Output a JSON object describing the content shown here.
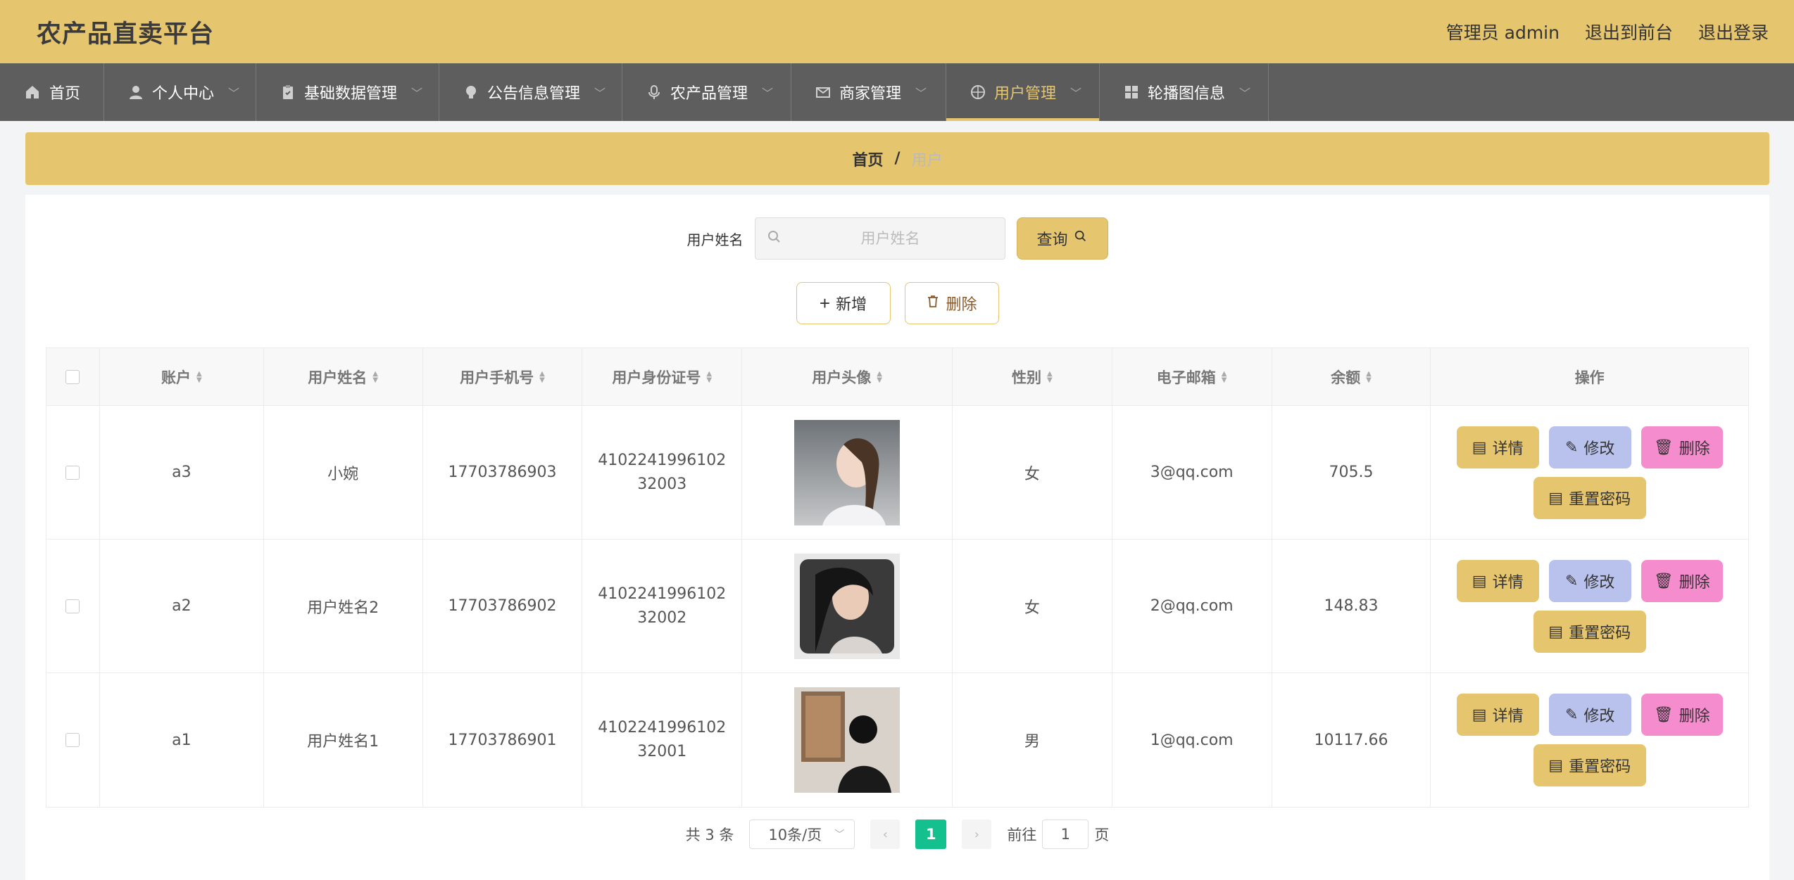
{
  "header": {
    "brand": "农产品直卖平台",
    "admin_label": "管理员 admin",
    "front_link": "退出到前台",
    "logout_link": "退出登录"
  },
  "nav": {
    "items": [
      {
        "label": "首页",
        "icon": "home-icon"
      },
      {
        "label": "个人中心",
        "icon": "user-icon"
      },
      {
        "label": "基础数据管理",
        "icon": "clipboard-icon"
      },
      {
        "label": "公告信息管理",
        "icon": "bulb-icon"
      },
      {
        "label": "农产品管理",
        "icon": "mic-icon"
      },
      {
        "label": "商家管理",
        "icon": "mail-icon"
      },
      {
        "label": "用户管理",
        "icon": "compass-icon"
      },
      {
        "label": "轮播图信息",
        "icon": "grid-icon"
      }
    ],
    "active": "用户管理"
  },
  "breadcrumb": {
    "home": "首页",
    "separator": "/",
    "current": "用户"
  },
  "search": {
    "label": "用户姓名",
    "placeholder": "用户姓名",
    "value": "",
    "button": "查询"
  },
  "actions": {
    "add": "新增",
    "delete": "删除"
  },
  "table": {
    "columns": [
      "账户",
      "用户姓名",
      "用户手机号",
      "用户身份证号",
      "用户头像",
      "性别",
      "电子邮箱",
      "余额",
      "操作"
    ],
    "rows": [
      {
        "account": "a3",
        "name": "小婉",
        "phone": "17703786903",
        "id_card": "410224199610232003",
        "gender": "女",
        "email": "3@qq.com",
        "balance": "705.5"
      },
      {
        "account": "a2",
        "name": "用户姓名2",
        "phone": "17703786902",
        "id_card": "410224199610232002",
        "gender": "女",
        "email": "2@qq.com",
        "balance": "148.83"
      },
      {
        "account": "a1",
        "name": "用户姓名1",
        "phone": "17703786901",
        "id_card": "410224199610232001",
        "gender": "男",
        "email": "1@qq.com",
        "balance": "10117.66"
      }
    ],
    "ops": {
      "detail": "详情",
      "edit": "修改",
      "delete": "删除",
      "reset": "重置密码"
    }
  },
  "pagination": {
    "total": "共 3 条",
    "page_size": "10条/页",
    "current": "1",
    "goto": "前往",
    "goto_value": "1",
    "page_suffix": "页"
  },
  "colors": {
    "accent": "#e6c56f",
    "nav_bg": "#5e5e5e",
    "edit": "#b9c2ec",
    "danger": "#f48ccd",
    "pager_active": "#13c08e"
  }
}
